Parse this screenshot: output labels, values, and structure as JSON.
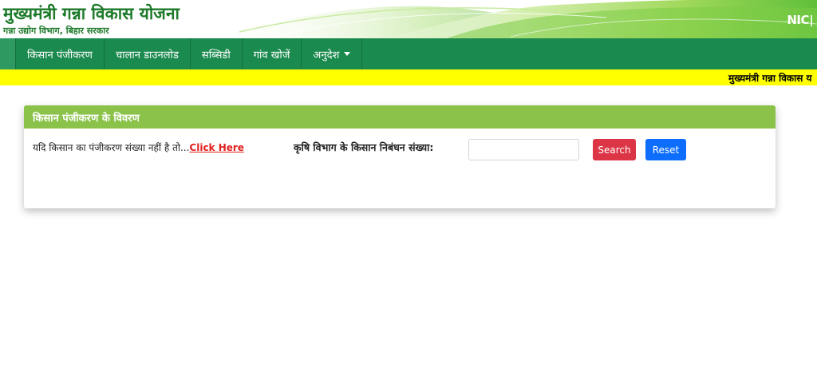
{
  "header": {
    "title": "मुख्यमंत्री गन्ना विकास योजना",
    "subtitle": "गन्ना उद्योग विभाग, बिहार सरकार",
    "logo_text": "NIC"
  },
  "nav": {
    "items": [
      {
        "label": "किसान पंजीकरण"
      },
      {
        "label": "चालान डाउनलोड"
      },
      {
        "label": "सब्सिडी"
      },
      {
        "label": "गांव खोजें"
      },
      {
        "label": "अनुदेश"
      }
    ]
  },
  "marquee": {
    "text": "मुख्यमंत्री गन्ना विकास य"
  },
  "panel": {
    "heading": "किसान पंजीकरण के विवरण",
    "no_reg_text": "यदि किसान का पंजीकरण संख्या नहीं है तो...",
    "click_here": "Click Here",
    "field_label": "कृषि विभाग के किसान निबंधन संख्या:",
    "input_value": "",
    "input_placeholder": "",
    "search_label": "Search",
    "reset_label": "Reset"
  },
  "colors": {
    "brand_green": "#1d7a2a",
    "nav_green": "#1a8a4e",
    "panel_heading": "#8bc34a",
    "marquee_bg": "#ffff00",
    "search_red": "#dc3545",
    "reset_blue": "#0d6efd",
    "link_red": "#e0201f"
  }
}
